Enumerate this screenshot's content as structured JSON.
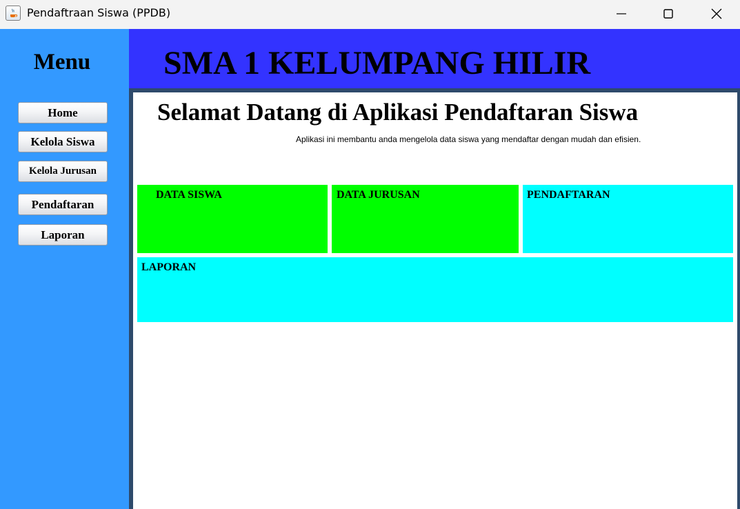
{
  "window": {
    "title": "Pendaftraan Siswa (PPDB)",
    "controls": [
      "minimize-icon",
      "maximize-icon",
      "close-icon"
    ]
  },
  "sidebar": {
    "title": "Menu",
    "items": [
      {
        "label": "Home"
      },
      {
        "label": "Kelola Siswa"
      },
      {
        "label": "Kelola Jurusan"
      },
      {
        "label": "Pendaftaran"
      },
      {
        "label": "Laporan"
      }
    ]
  },
  "header": {
    "title": "SMA 1 KELUMPANG HILIR"
  },
  "main": {
    "welcome_title": "Selamat Datang di Aplikasi Pendaftaran Siswa",
    "welcome_description": "Aplikasi ini membantu anda mengelola data siswa yang mendaftar dengan mudah dan efisien.",
    "panels": [
      {
        "label": "DATA SISWA",
        "color": "#00ff00"
      },
      {
        "label": "DATA JURUSAN",
        "color": "#00ff00"
      },
      {
        "label": "PENDAFTARAN",
        "color": "#00ffff"
      },
      {
        "label": "LAPORAN",
        "color": "#00ffff"
      }
    ]
  },
  "colors": {
    "sidebar_bg": "#3399ff",
    "header_bg": "#3333ff",
    "content_bg": "#ffffff"
  }
}
